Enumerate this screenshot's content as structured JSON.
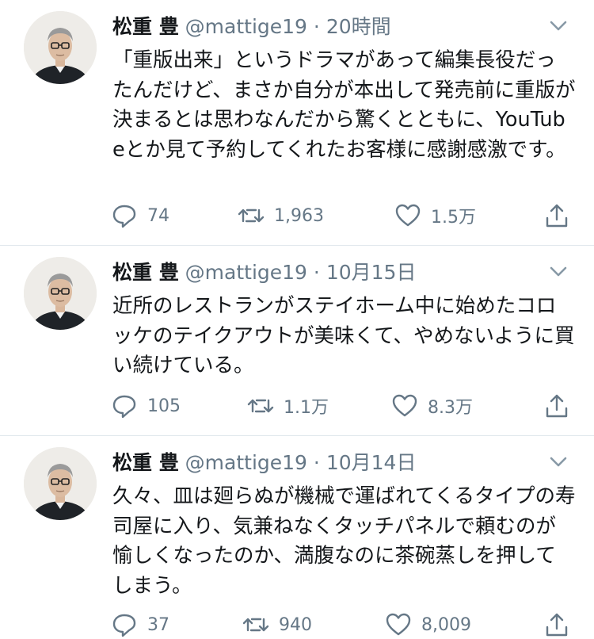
{
  "tweets": [
    {
      "name": "松重 豊",
      "handle": "@mattige19",
      "separator": "·",
      "time": "20時間",
      "text": "「重版出来」というドラマがあって編集長役だったんだけど、まさか自分が本出して発売前に重版が決まるとは思わなんだから驚くとともに、YouTubeとか見て予約してくれたお客様に感謝感激です。",
      "replies": "74",
      "retweets": "1,963",
      "likes": "1.5万"
    },
    {
      "name": "松重 豊",
      "handle": "@mattige19",
      "separator": "·",
      "time": "10月15日",
      "text": "近所のレストランがステイホーム中に始めたコロッケのテイクアウトが美味くて、やめないように買い続けている。",
      "replies": "105",
      "retweets": "1.1万",
      "likes": "8.3万"
    },
    {
      "name": "松重 豊",
      "handle": "@mattige19",
      "separator": "·",
      "time": "10月14日",
      "text": "久々、皿は廻らぬが機械で運ばれてくるタイプの寿司屋に入り、気兼ねなくタッチパネルで頼むのが愉しくなったのか、満腹なのに茶碗蒸しを押してしまう。",
      "replies": "37",
      "retweets": "940",
      "likes": "8,009"
    }
  ],
  "icons": {
    "reply": "reply-icon",
    "retweet": "retweet-icon",
    "like": "heart-icon",
    "share": "share-icon",
    "more": "chevron-down-icon"
  },
  "colors": {
    "text": "#14171a",
    "secondary": "#657786",
    "divider": "#e1e8ed"
  }
}
